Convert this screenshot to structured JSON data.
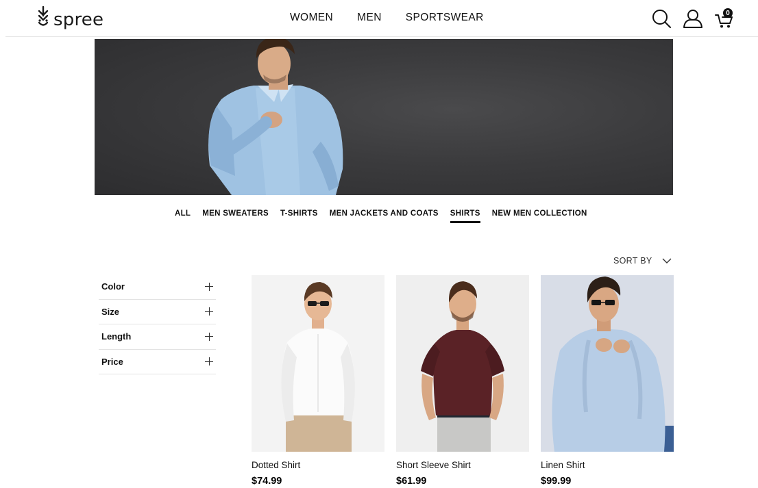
{
  "brand": {
    "name": "spree"
  },
  "nav": {
    "items": [
      {
        "label": "WOMEN"
      },
      {
        "label": "MEN"
      },
      {
        "label": "SPORTSWEAR"
      }
    ]
  },
  "header_icons": {
    "search": "search-icon",
    "account": "user-icon",
    "cart": "cart-icon"
  },
  "cart": {
    "count": "0"
  },
  "categories": {
    "items": [
      {
        "label": "ALL"
      },
      {
        "label": "MEN SWEATERS"
      },
      {
        "label": "T-SHIRTS"
      },
      {
        "label": "MEN JACKETS AND COATS"
      },
      {
        "label": "SHIRTS"
      },
      {
        "label": "NEW MEN COLLECTION"
      }
    ],
    "active": "SHIRTS"
  },
  "sort": {
    "label": "SORT BY"
  },
  "filters": [
    {
      "label": "Color"
    },
    {
      "label": "Size"
    },
    {
      "label": "Length"
    },
    {
      "label": "Price"
    }
  ],
  "products": [
    {
      "name": "Dotted Shirt",
      "price": "$74.99"
    },
    {
      "name": "Short Sleeve Shirt",
      "price": "$61.99"
    },
    {
      "name": "Linen Shirt",
      "price": "$99.99"
    }
  ],
  "colors": {
    "text": "#111111",
    "hero_bg": "#3b3b3d",
    "divider": "#e2e2e2"
  }
}
